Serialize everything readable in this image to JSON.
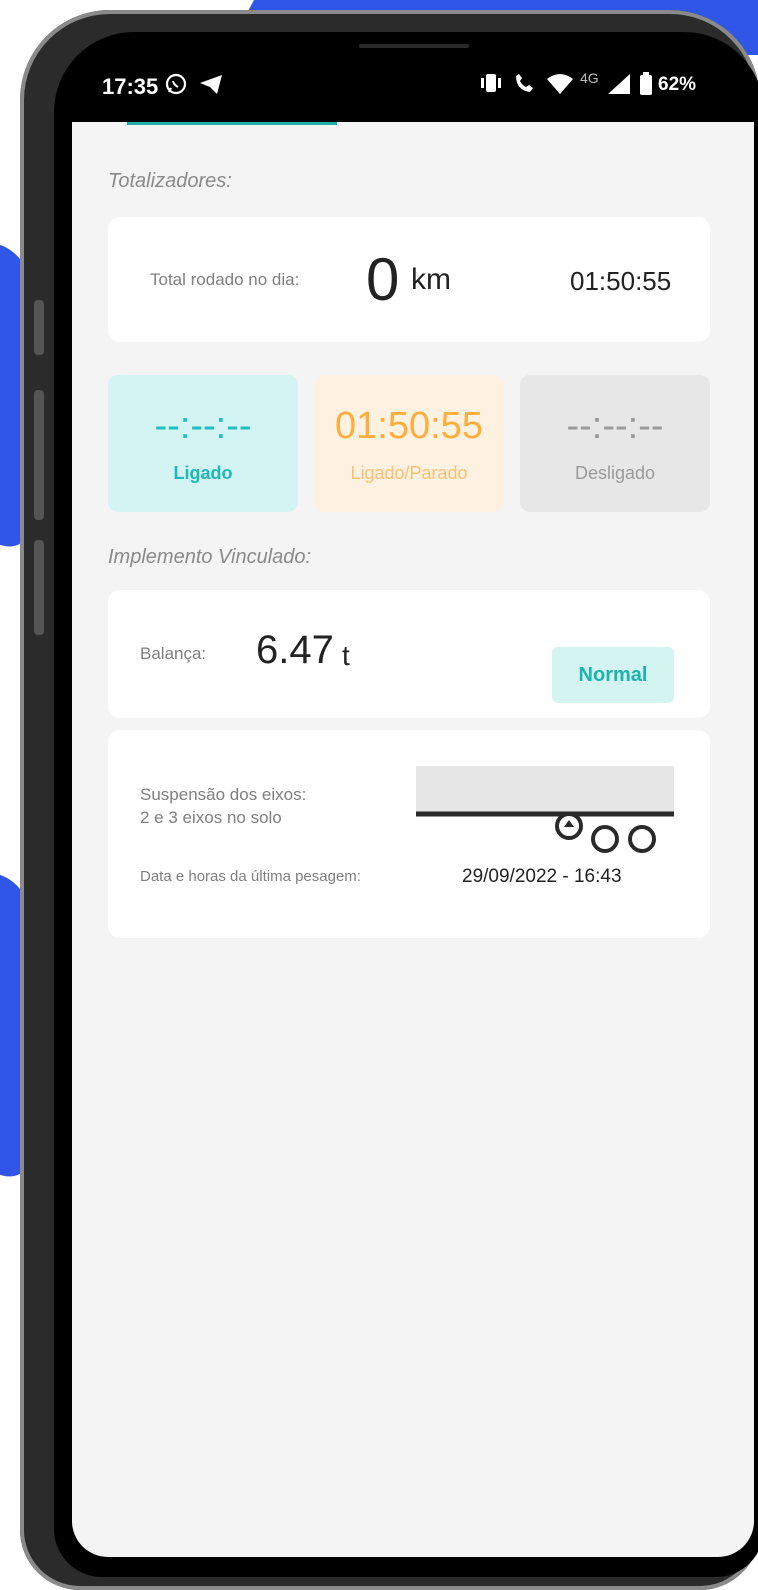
{
  "status_bar": {
    "time": "17:35",
    "icons": [
      "whatsapp-icon",
      "telegram-icon",
      "vibrate-icon",
      "call-icon",
      "wifi-icon",
      "signal-icon",
      "battery-icon"
    ],
    "network_label": "4G",
    "battery": "62%"
  },
  "totalizadores": {
    "title": "Totalizadores:",
    "total_label": "Total rodado no dia:",
    "total_value": "0",
    "total_unit": "km",
    "total_time": "01:50:55",
    "states": [
      {
        "value": "--:--:--",
        "label": "Ligado",
        "color": "#1fc0c0",
        "bg": "#d3f4f2"
      },
      {
        "value": "01:50:55",
        "label": "Ligado/Parado",
        "color": "#ffae3d",
        "bg": "#fdf1e1"
      },
      {
        "value": "--:--:--",
        "label": "Desligado",
        "color": "#9a9a9a",
        "bg": "#e7e7e7"
      }
    ]
  },
  "implemento": {
    "title": "Implemento Vinculado:",
    "balanca_label": "Balança:",
    "balanca_value": "6.47",
    "balanca_unit": "t",
    "status": "Normal",
    "suspensao_line1": "Suspensão dos eixos:",
    "suspensao_line2": "2 e 3 eixos no solo",
    "last_weigh_label": "Data e horas da última pesagem:",
    "last_weigh_value": "29/09/2022 - 16:43"
  },
  "colors": {
    "accent": "#1fb0a8",
    "background_blue": "#2f56e6"
  }
}
